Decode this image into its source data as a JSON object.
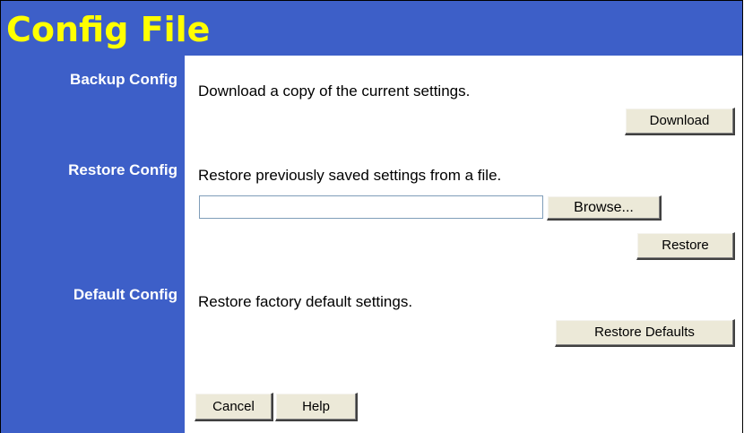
{
  "page": {
    "title": "Config File"
  },
  "sections": {
    "backup": {
      "label": "Backup Config",
      "description": "Download a copy of the current settings.",
      "button_label": "Download"
    },
    "restore": {
      "label": "Restore Config",
      "description": "Restore previously saved settings from a file.",
      "file_input_value": "",
      "browse_label": "Browse...",
      "button_label": "Restore"
    },
    "default": {
      "label": "Default Config",
      "description": "Restore factory default settings.",
      "button_label": "Restore Defaults"
    }
  },
  "footer": {
    "cancel_label": "Cancel",
    "help_label": "Help"
  },
  "colors": {
    "panel_blue": "#3d5fc8",
    "title_yellow": "#ffff00",
    "button_face": "#ece9d8"
  }
}
